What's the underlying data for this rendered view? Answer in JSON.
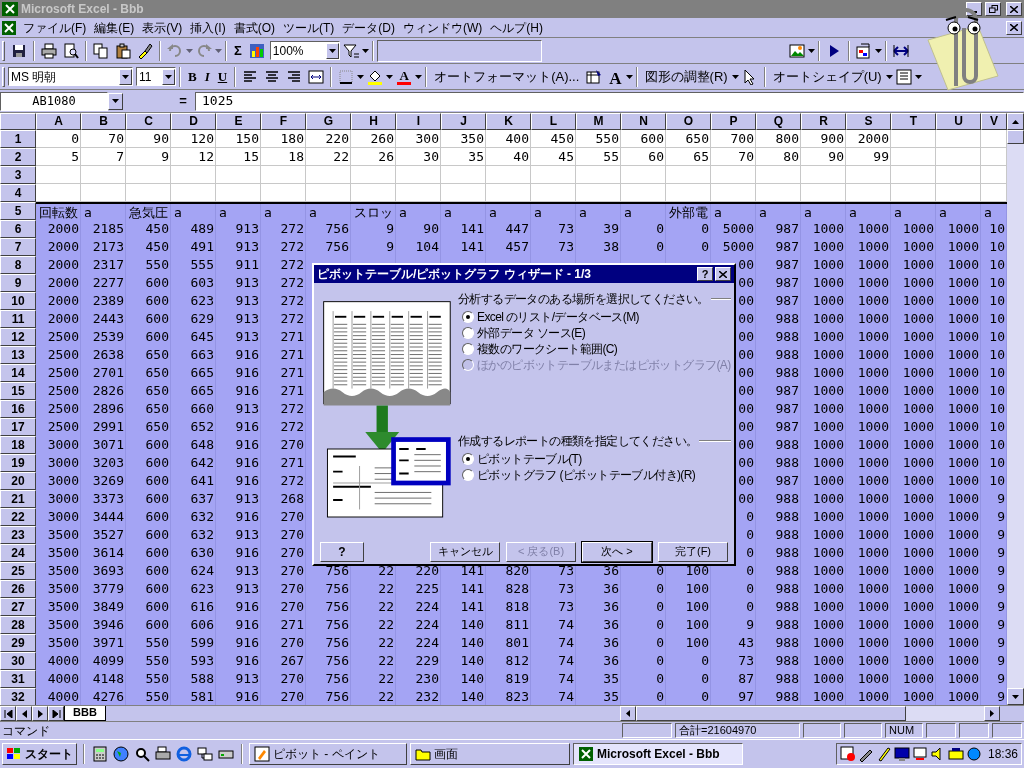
{
  "title_bar": {
    "title": "Microsoft Excel - Bbb"
  },
  "menu_bar": [
    {
      "label": "ファイル(F)"
    },
    {
      "label": "編集(E)"
    },
    {
      "label": "表示(V)"
    },
    {
      "label": "挿入(I)"
    },
    {
      "label": "書式(O)"
    },
    {
      "label": "ツール(T)"
    },
    {
      "label": "データ(D)"
    },
    {
      "label": "ウィンドウ(W)"
    },
    {
      "label": "ヘルプ(H)"
    }
  ],
  "standard_toolbar": {
    "sum": "Σ",
    "zoom": "100%"
  },
  "formatting_toolbar": {
    "font": "MS 明朝",
    "size": "11",
    "bold": "B",
    "italic": "I",
    "underline": "U",
    "font_color": "A",
    "autoformat": "オートフォーマット(A)...",
    "font_size_icon": "A",
    "draw": "図形の調整(R)",
    "autoshape": "オートシェイプ(U)"
  },
  "formula_bar": {
    "name_box": "AB1080",
    "equals": "=",
    "value": "1025"
  },
  "sheet": {
    "columns": [
      "A",
      "B",
      "C",
      "D",
      "E",
      "F",
      "G",
      "H",
      "I",
      "J",
      "K",
      "L",
      "M",
      "N",
      "O",
      "P",
      "Q",
      "R",
      "S",
      "T",
      "U",
      "V"
    ],
    "rows": [
      {
        "header": "1",
        "kind": "numbers",
        "selected": false,
        "cells": [
          "0",
          "70",
          "90",
          "120",
          "150",
          "180",
          "220",
          "260",
          "300",
          "350",
          "400",
          "450",
          "550",
          "600",
          "650",
          "700",
          "800",
          "900",
          "2000"
        ]
      },
      {
        "header": "2",
        "kind": "numbers",
        "selected": false,
        "cells": [
          "5",
          "7",
          "9",
          "12",
          "15",
          "18",
          "22",
          "26",
          "30",
          "35",
          "40",
          "45",
          "55",
          "60",
          "65",
          "70",
          "80",
          "90",
          "99"
        ]
      },
      {
        "header": "3",
        "kind": "numbers",
        "selected": false
      },
      {
        "header": "4",
        "kind": "numbers",
        "selected": false
      },
      {
        "header": "5",
        "kind": "labels",
        "selected": true,
        "cells": [
          "回転数",
          "a",
          "急気圧",
          "a",
          "a",
          "a",
          "a",
          "スロッ",
          "a",
          "a",
          "a",
          "a",
          "a",
          "a",
          "外部電",
          "a",
          "a",
          "a",
          "a",
          "a",
          "a",
          "a"
        ]
      },
      {
        "header": "6",
        "kind": "numbers",
        "selected": true,
        "cells": [
          "2000",
          "2185",
          "450",
          "489",
          "913",
          "272",
          "756",
          "9",
          "90",
          "141",
          "447",
          "73",
          "39",
          "0",
          "0",
          "5000",
          "987",
          "1000",
          "1000",
          "1000",
          "1000",
          "10"
        ]
      },
      {
        "header": "7",
        "kind": "numbers",
        "selected": true,
        "cells": [
          "2000",
          "2173",
          "450",
          "491",
          "913",
          "272",
          "756",
          "9",
          "104",
          "141",
          "457",
          "73",
          "38",
          "0",
          "0",
          "5000",
          "987",
          "1000",
          "1000",
          "1000",
          "1000",
          "10"
        ]
      },
      {
        "header": "8",
        "kind": "numbers",
        "selected": true,
        "cells": [
          "2000",
          "2317",
          "550",
          "555",
          "911",
          "272",
          null,
          null,
          null,
          null,
          null,
          null,
          null,
          null,
          null,
          "00",
          "987",
          "1000",
          "1000",
          "1000",
          "1000",
          "10"
        ]
      },
      {
        "header": "9",
        "kind": "numbers",
        "selected": true,
        "cells": [
          "2000",
          "2277",
          "600",
          "603",
          "913",
          "272",
          null,
          null,
          null,
          null,
          null,
          null,
          null,
          null,
          null,
          "00",
          "987",
          "1000",
          "1000",
          "1000",
          "1000",
          "10"
        ]
      },
      {
        "header": "10",
        "kind": "numbers",
        "selected": true,
        "cells": [
          "2000",
          "2389",
          "600",
          "623",
          "913",
          "272",
          null,
          null,
          null,
          null,
          null,
          null,
          null,
          null,
          null,
          "00",
          "987",
          "1000",
          "1000",
          "1000",
          "1000",
          "10"
        ]
      },
      {
        "header": "11",
        "kind": "numbers",
        "selected": true,
        "cells": [
          "2000",
          "2443",
          "600",
          "629",
          "913",
          "272",
          null,
          null,
          null,
          null,
          null,
          null,
          null,
          null,
          null,
          "00",
          "988",
          "1000",
          "1000",
          "1000",
          "1000",
          "10"
        ]
      },
      {
        "header": "12",
        "kind": "numbers",
        "selected": true,
        "cells": [
          "2500",
          "2539",
          "600",
          "645",
          "913",
          "271",
          null,
          null,
          null,
          null,
          null,
          null,
          null,
          null,
          null,
          "00",
          "988",
          "1000",
          "1000",
          "1000",
          "1000",
          "10"
        ]
      },
      {
        "header": "13",
        "kind": "numbers",
        "selected": true,
        "cells": [
          "2500",
          "2638",
          "650",
          "663",
          "916",
          "271",
          null,
          null,
          null,
          null,
          null,
          null,
          null,
          null,
          null,
          "00",
          "988",
          "1000",
          "1000",
          "1000",
          "1000",
          "10"
        ]
      },
      {
        "header": "14",
        "kind": "numbers",
        "selected": true,
        "cells": [
          "2500",
          "2701",
          "650",
          "665",
          "916",
          "271",
          null,
          null,
          null,
          null,
          null,
          null,
          null,
          null,
          null,
          "00",
          "988",
          "1000",
          "1000",
          "1000",
          "1000",
          "10"
        ]
      },
      {
        "header": "15",
        "kind": "numbers",
        "selected": true,
        "cells": [
          "2500",
          "2826",
          "650",
          "665",
          "916",
          "271",
          null,
          null,
          null,
          null,
          null,
          null,
          null,
          null,
          null,
          "00",
          "987",
          "1000",
          "1000",
          "1000",
          "1000",
          "10"
        ]
      },
      {
        "header": "16",
        "kind": "numbers",
        "selected": true,
        "cells": [
          "2500",
          "2896",
          "650",
          "660",
          "913",
          "272",
          null,
          null,
          null,
          null,
          null,
          null,
          null,
          null,
          null,
          "00",
          "987",
          "1000",
          "1000",
          "1000",
          "1000",
          "10"
        ]
      },
      {
        "header": "17",
        "kind": "numbers",
        "selected": true,
        "cells": [
          "2500",
          "2991",
          "650",
          "652",
          "916",
          "272",
          null,
          null,
          null,
          null,
          null,
          null,
          null,
          null,
          null,
          "00",
          "987",
          "1000",
          "1000",
          "1000",
          "1000",
          "10"
        ]
      },
      {
        "header": "18",
        "kind": "numbers",
        "selected": true,
        "cells": [
          "3000",
          "3071",
          "600",
          "648",
          "916",
          "270",
          null,
          null,
          null,
          null,
          null,
          null,
          null,
          null,
          null,
          "00",
          "988",
          "1000",
          "1000",
          "1000",
          "1000",
          "10"
        ]
      },
      {
        "header": "19",
        "kind": "numbers",
        "selected": true,
        "cells": [
          "3000",
          "3203",
          "600",
          "642",
          "916",
          "271",
          null,
          null,
          null,
          null,
          null,
          null,
          null,
          null,
          null,
          "00",
          "988",
          "1000",
          "1000",
          "1000",
          "1000",
          "10"
        ]
      },
      {
        "header": "20",
        "kind": "numbers",
        "selected": true,
        "cells": [
          "3000",
          "3269",
          "600",
          "641",
          "916",
          "272",
          null,
          null,
          null,
          null,
          null,
          null,
          null,
          null,
          null,
          "00",
          "987",
          "1000",
          "1000",
          "1000",
          "1000",
          "10"
        ]
      },
      {
        "header": "21",
        "kind": "numbers",
        "selected": true,
        "cells": [
          "3000",
          "3373",
          "600",
          "637",
          "913",
          "268",
          null,
          null,
          null,
          null,
          null,
          null,
          null,
          null,
          null,
          "00",
          "988",
          "1000",
          "1000",
          "1000",
          "1000",
          "9"
        ]
      },
      {
        "header": "22",
        "kind": "numbers",
        "selected": true,
        "cells": [
          "3000",
          "3444",
          "600",
          "632",
          "916",
          "270",
          null,
          null,
          null,
          null,
          null,
          null,
          null,
          null,
          null,
          "0",
          "988",
          "1000",
          "1000",
          "1000",
          "1000",
          "9"
        ]
      },
      {
        "header": "23",
        "kind": "numbers",
        "selected": true,
        "cells": [
          "3500",
          "3527",
          "600",
          "632",
          "913",
          "270",
          null,
          null,
          null,
          null,
          null,
          null,
          null,
          null,
          null,
          "0",
          "988",
          "1000",
          "1000",
          "1000",
          "1000",
          "9"
        ]
      },
      {
        "header": "24",
        "kind": "numbers",
        "selected": true,
        "cells": [
          "3500",
          "3614",
          "600",
          "630",
          "916",
          "270",
          null,
          null,
          null,
          null,
          null,
          null,
          null,
          null,
          null,
          "0",
          "988",
          "1000",
          "1000",
          "1000",
          "1000",
          "9"
        ]
      },
      {
        "header": "25",
        "kind": "numbers",
        "selected": true,
        "cells": [
          "3500",
          "3693",
          "600",
          "624",
          "913",
          "270",
          "756",
          "22",
          "220",
          "141",
          "820",
          "73",
          "36",
          "0",
          "100",
          "0",
          "988",
          "1000",
          "1000",
          "1000",
          "1000",
          "9"
        ]
      },
      {
        "header": "26",
        "kind": "numbers",
        "selected": true,
        "cells": [
          "3500",
          "3779",
          "600",
          "623",
          "913",
          "270",
          "756",
          "22",
          "225",
          "141",
          "828",
          "73",
          "36",
          "0",
          "100",
          "0",
          "988",
          "1000",
          "1000",
          "1000",
          "1000",
          "9"
        ]
      },
      {
        "header": "27",
        "kind": "numbers",
        "selected": true,
        "cells": [
          "3500",
          "3849",
          "600",
          "616",
          "916",
          "270",
          "756",
          "22",
          "224",
          "141",
          "818",
          "73",
          "36",
          "0",
          "100",
          "0",
          "988",
          "1000",
          "1000",
          "1000",
          "1000",
          "9"
        ]
      },
      {
        "header": "28",
        "kind": "numbers",
        "selected": true,
        "cells": [
          "3500",
          "3946",
          "600",
          "606",
          "916",
          "271",
          "756",
          "22",
          "224",
          "140",
          "811",
          "74",
          "36",
          "0",
          "100",
          "9",
          "988",
          "1000",
          "1000",
          "1000",
          "1000",
          "9"
        ]
      },
      {
        "header": "29",
        "kind": "numbers",
        "selected": true,
        "cells": [
          "3500",
          "3971",
          "550",
          "599",
          "916",
          "270",
          "756",
          "22",
          "224",
          "140",
          "801",
          "74",
          "36",
          "0",
          "100",
          "43",
          "988",
          "1000",
          "1000",
          "1000",
          "1000",
          "9"
        ]
      },
      {
        "header": "30",
        "kind": "numbers",
        "selected": true,
        "cells": [
          "4000",
          "4099",
          "550",
          "593",
          "916",
          "267",
          "756",
          "22",
          "229",
          "140",
          "812",
          "74",
          "36",
          "0",
          "0",
          "73",
          "988",
          "1000",
          "1000",
          "1000",
          "1000",
          "9"
        ]
      },
      {
        "header": "31",
        "kind": "numbers",
        "selected": true,
        "cells": [
          "4000",
          "4148",
          "550",
          "588",
          "913",
          "270",
          "756",
          "22",
          "230",
          "140",
          "819",
          "74",
          "35",
          "0",
          "0",
          "87",
          "988",
          "1000",
          "1000",
          "1000",
          "1000",
          "9"
        ]
      },
      {
        "header": "32",
        "kind": "numbers",
        "selected": true,
        "cells": [
          "4000",
          "4276",
          "550",
          "581",
          "916",
          "270",
          "756",
          "22",
          "232",
          "140",
          "823",
          "74",
          "35",
          "0",
          "0",
          "97",
          "988",
          "1000",
          "1000",
          "1000",
          "1000",
          "9"
        ]
      }
    ]
  },
  "dialog": {
    "title": "ピボットテーブル/ピボットグラフ ウィザード - 1/3",
    "help": "?",
    "source_label": "分析するデータのある場所を選択してください。",
    "sources": [
      {
        "label": "Excel のリスト/データベース(M)",
        "selected": true,
        "disabled": false
      },
      {
        "label": "外部データ ソース(E)",
        "selected": false,
        "disabled": false
      },
      {
        "label": "複数のワークシート範囲(C)",
        "selected": false,
        "disabled": false
      },
      {
        "label": "ほかのピボットテーブルまたはピボットグラフ(A)",
        "selected": false,
        "disabled": true
      }
    ],
    "report_label": "作成するレポートの種類を指定してください。",
    "reports": [
      {
        "label": "ピボットテーブル(T)",
        "selected": true,
        "disabled": false
      },
      {
        "label": "ピボットグラフ (ピボットテーブル付き)(R)",
        "selected": false,
        "disabled": false
      }
    ],
    "buttons": [
      {
        "label": "キャンセル",
        "disabled": false,
        "default": false
      },
      {
        "label": "< 戻る(B)",
        "disabled": true,
        "default": false
      },
      {
        "label": "次へ >",
        "disabled": false,
        "default": true
      },
      {
        "label": "完了(F)",
        "disabled": false,
        "default": false
      }
    ]
  },
  "sheet_tabs": [
    {
      "label": "BBB",
      "selected": true
    }
  ],
  "status_bar": {
    "mode": "コマンド",
    "sum": "合計=21604970",
    "num": "NUM"
  },
  "taskbar": {
    "start": "スタート",
    "tasks": [
      {
        "label": "ピボット - ペイント",
        "selected": false
      },
      {
        "label": "画面",
        "selected": false
      },
      {
        "label": "Microsoft Excel - Bbb",
        "selected": true
      }
    ],
    "clock": "18:36"
  }
}
